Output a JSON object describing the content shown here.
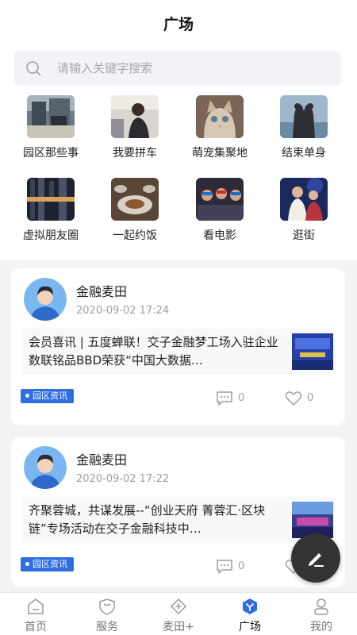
{
  "header": {
    "title": "广场"
  },
  "search": {
    "placeholder": "请输入关键字搜索"
  },
  "categories": [
    {
      "label": "园区那些事"
    },
    {
      "label": "我要拼车"
    },
    {
      "label": "萌宠集聚地"
    },
    {
      "label": "结束单身"
    },
    {
      "label": "虚拟朋友圈"
    },
    {
      "label": "一起约饭"
    },
    {
      "label": "看电影"
    },
    {
      "label": "逛街"
    }
  ],
  "posts": [
    {
      "author": "金融麦田",
      "time": "2020-09-02 17:24",
      "text": "会员喜讯 | 五度蝉联！交子金融梦工场入驻企业数联铭品BBD荣获“中国大数据…",
      "tag": "园区资讯",
      "comments": "0",
      "likes": "0"
    },
    {
      "author": "金融麦田",
      "time": "2020-09-02 17:22",
      "text": "齐聚蓉城，共谋发展--“创业天府 菁蓉汇·区块链”专场活动在交子金融科技中…",
      "tag": "园区资讯",
      "comments": "0",
      "likes": "0"
    }
  ],
  "tabbar": {
    "items": [
      {
        "label": "首页",
        "icon": "home-icon"
      },
      {
        "label": "服务",
        "icon": "service-shield-icon"
      },
      {
        "label": "麦田+",
        "icon": "plus-diamond-icon"
      },
      {
        "label": "广场",
        "icon": "square-icon",
        "active": true
      },
      {
        "label": "我的",
        "icon": "profile-icon"
      }
    ]
  },
  "colors": {
    "accent": "#2f6ee0",
    "tag_bg": "#2f6ee0",
    "fab": "#333333",
    "page_bg": "#f2f3f5"
  }
}
